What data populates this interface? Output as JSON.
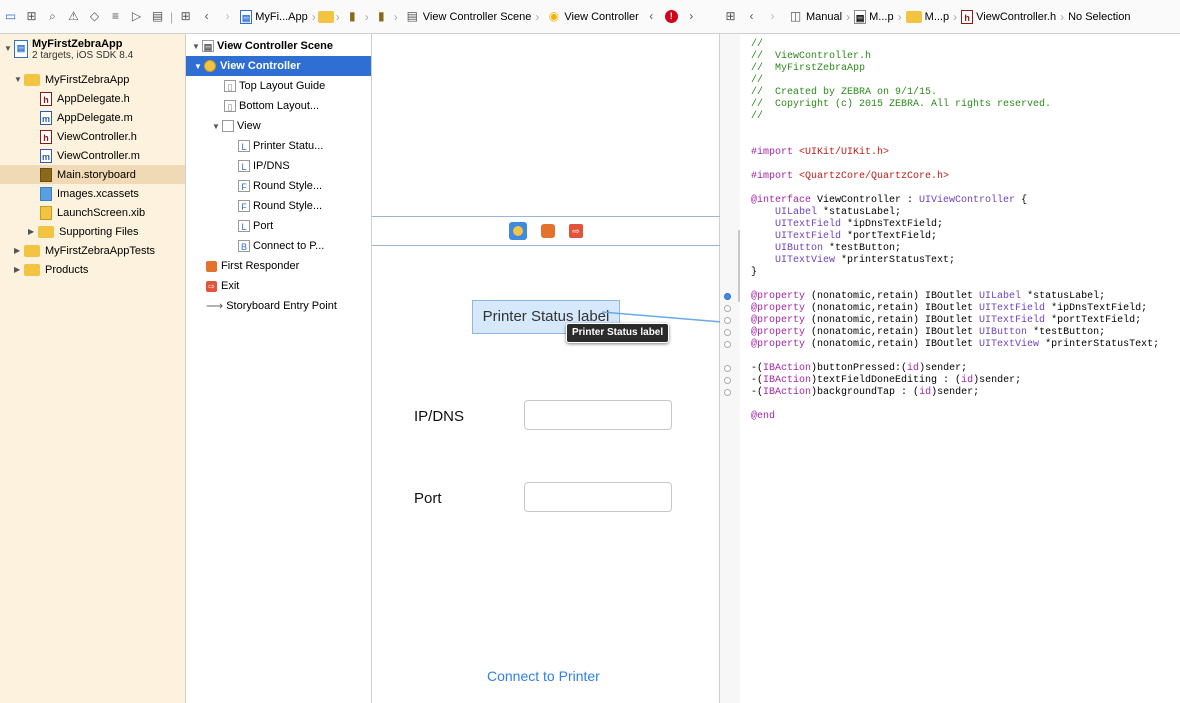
{
  "left_bar": {
    "crumbs": [
      "MyFi...App",
      "View Controller Scene",
      "View Controller"
    ]
  },
  "right_bar": {
    "crumbs": [
      "Manual",
      "M...p",
      "M...p",
      "ViewController.h",
      "No Selection"
    ]
  },
  "navigator": {
    "project": {
      "name": "MyFirstZebraApp",
      "subtitle": "2 targets, iOS SDK 8.4"
    },
    "items": [
      {
        "label": "MyFirstZebraApp",
        "kind": "folder",
        "depth": 1,
        "open": true
      },
      {
        "label": "AppDelegate.h",
        "kind": "h",
        "depth": 2
      },
      {
        "label": "AppDelegate.m",
        "kind": "m",
        "depth": 2
      },
      {
        "label": "ViewController.h",
        "kind": "h",
        "depth": 2
      },
      {
        "label": "ViewController.m",
        "kind": "m",
        "depth": 2
      },
      {
        "label": "Main.storyboard",
        "kind": "sb",
        "depth": 2,
        "selected": true
      },
      {
        "label": "Images.xcassets",
        "kind": "assets",
        "depth": 2
      },
      {
        "label": "LaunchScreen.xib",
        "kind": "xib",
        "depth": 2
      },
      {
        "label": "Supporting Files",
        "kind": "folder",
        "depth": 2,
        "open": false
      },
      {
        "label": "MyFirstZebraAppTests",
        "kind": "folder",
        "depth": 1,
        "open": false
      },
      {
        "label": "Products",
        "kind": "folder",
        "depth": 1,
        "open": false
      }
    ]
  },
  "outline": {
    "scene": "View Controller Scene",
    "items": [
      {
        "label": "View Controller",
        "depth": 1,
        "icon": "vc",
        "selected": true
      },
      {
        "label": "Top Layout Guide",
        "depth": 2,
        "icon": "guide"
      },
      {
        "label": "Bottom Layout...",
        "depth": 2,
        "icon": "guide"
      },
      {
        "label": "View",
        "depth": 2,
        "icon": "view",
        "open": true
      },
      {
        "label": "Printer Statu...",
        "depth": 3,
        "icon": "L"
      },
      {
        "label": "IP/DNS",
        "depth": 3,
        "icon": "L"
      },
      {
        "label": "Round Style...",
        "depth": 3,
        "icon": "F"
      },
      {
        "label": "Round Style...",
        "depth": 3,
        "icon": "F"
      },
      {
        "label": "Port",
        "depth": 3,
        "icon": "L"
      },
      {
        "label": "Connect to P...",
        "depth": 3,
        "icon": "B"
      },
      {
        "label": "First Responder",
        "depth": 1,
        "icon": "fr"
      },
      {
        "label": "Exit",
        "depth": 1,
        "icon": "exit"
      },
      {
        "label": "Storyboard Entry Point",
        "depth": 1,
        "icon": "arrow"
      }
    ]
  },
  "canvas": {
    "status_label": "Printer Status label",
    "tooltip": "Printer Status label",
    "ip_label": "IP/DNS",
    "port_label": "Port",
    "connect_button": "Connect to Printer"
  },
  "code_lines": [
    [
      {
        "t": "//",
        "c": "cm"
      }
    ],
    [
      {
        "t": "//  ViewController.h",
        "c": "cm"
      }
    ],
    [
      {
        "t": "//  MyFirstZebraApp",
        "c": "cm"
      }
    ],
    [
      {
        "t": "//",
        "c": "cm"
      }
    ],
    [
      {
        "t": "//  Created by ZEBRA on 9/1/15.",
        "c": "cm"
      }
    ],
    [
      {
        "t": "//  Copyright (c) 2015 ZEBRA. All rights reserved.",
        "c": "cm"
      }
    ],
    [
      {
        "t": "//",
        "c": "cm"
      }
    ],
    [],
    [],
    [
      {
        "t": "#import ",
        "c": "kw"
      },
      {
        "t": "<UIKit/UIKit.h>",
        "c": "str"
      }
    ],
    [],
    [
      {
        "t": "#import ",
        "c": "kw"
      },
      {
        "t": "<QuartzCore/QuartzCore.h>",
        "c": "str"
      }
    ],
    [],
    [
      {
        "t": "@interface ",
        "c": "kw"
      },
      {
        "t": "ViewController : "
      },
      {
        "t": "UIViewController",
        "c": "ty"
      },
      {
        "t": " {"
      }
    ],
    [
      {
        "t": "    "
      },
      {
        "t": "UILabel",
        "c": "ty"
      },
      {
        "t": " *statusLabel;"
      }
    ],
    [
      {
        "t": "    "
      },
      {
        "t": "UITextField",
        "c": "ty"
      },
      {
        "t": " *ipDnsTextField;"
      }
    ],
    [
      {
        "t": "    "
      },
      {
        "t": "UITextField",
        "c": "ty"
      },
      {
        "t": " *portTextField;"
      }
    ],
    [
      {
        "t": "    "
      },
      {
        "t": "UIButton",
        "c": "ty"
      },
      {
        "t": " *testButton;"
      }
    ],
    [
      {
        "t": "    "
      },
      {
        "t": "UITextView",
        "c": "ty"
      },
      {
        "t": " *printerStatusText;"
      }
    ],
    [
      {
        "t": "}"
      }
    ],
    [],
    [
      {
        "t": "@property ",
        "c": "kw"
      },
      {
        "t": "(nonatomic,retain) IBOutlet "
      },
      {
        "t": "UILabel",
        "c": "ty"
      },
      {
        "t": " *statusLabel;"
      }
    ],
    [
      {
        "t": "@property ",
        "c": "kw"
      },
      {
        "t": "(nonatomic,retain) IBOutlet "
      },
      {
        "t": "UITextField",
        "c": "ty"
      },
      {
        "t": " *ipDnsTextField;"
      }
    ],
    [
      {
        "t": "@property ",
        "c": "kw"
      },
      {
        "t": "(nonatomic,retain) IBOutlet "
      },
      {
        "t": "UITextField",
        "c": "ty"
      },
      {
        "t": " *portTextField;"
      }
    ],
    [
      {
        "t": "@property ",
        "c": "kw"
      },
      {
        "t": "(nonatomic,retain) IBOutlet "
      },
      {
        "t": "UIButton",
        "c": "ty"
      },
      {
        "t": " *testButton;"
      }
    ],
    [
      {
        "t": "@property ",
        "c": "kw"
      },
      {
        "t": "(nonatomic,retain) IBOutlet "
      },
      {
        "t": "UITextView",
        "c": "ty"
      },
      {
        "t": " *printerStatusText;"
      }
    ],
    [],
    [
      {
        "t": "-("
      },
      {
        "t": "IBAction",
        "c": "kw"
      },
      {
        "t": ")buttonPressed:("
      },
      {
        "t": "id",
        "c": "kw"
      },
      {
        "t": ")sender;"
      }
    ],
    [
      {
        "t": "-("
      },
      {
        "t": "IBAction",
        "c": "kw"
      },
      {
        "t": ")textFieldDoneEditing : ("
      },
      {
        "t": "id",
        "c": "kw"
      },
      {
        "t": ")sender;"
      }
    ],
    [
      {
        "t": "-("
      },
      {
        "t": "IBAction",
        "c": "kw"
      },
      {
        "t": ")backgroundTap : ("
      },
      {
        "t": "id",
        "c": "kw"
      },
      {
        "t": ")sender;"
      }
    ],
    [],
    [
      {
        "t": "@end",
        "c": "kw"
      }
    ]
  ]
}
